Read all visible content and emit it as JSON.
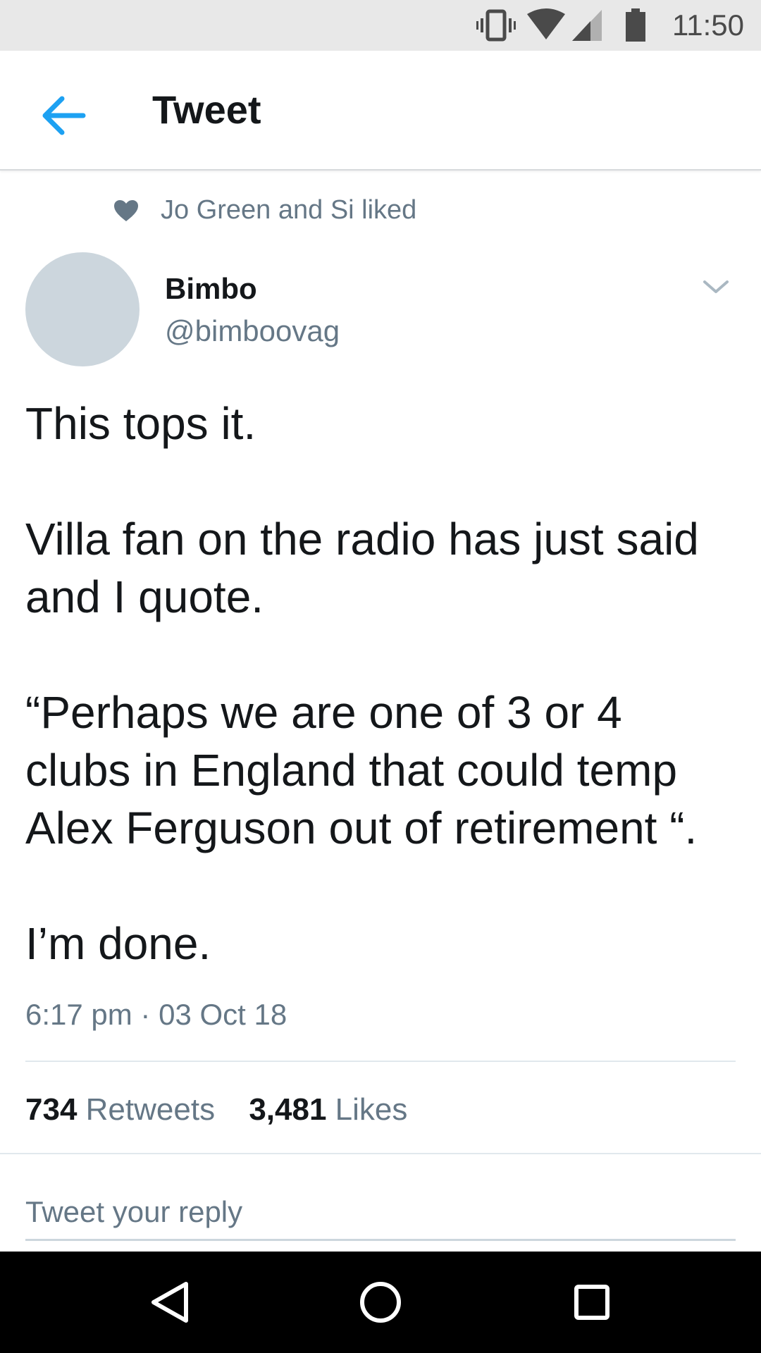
{
  "status_bar": {
    "time": "11:50",
    "icons": [
      "vibrate-icon",
      "wifi-icon",
      "signal-icon",
      "battery-icon"
    ]
  },
  "app_bar": {
    "title": "Tweet",
    "back_icon": "arrow-left-icon",
    "accent_color": "#1da1f2"
  },
  "social_context": {
    "text": "Jo Green and Si liked",
    "icon": "heart-icon"
  },
  "tweet": {
    "author": {
      "name": "Bimbo",
      "handle": "@bimboovag"
    },
    "paragraphs": [
      "This tops it.",
      "Villa fan on the radio has just said and I quote.",
      "“Perhaps we are one of 3 or 4 clubs in England that could temp Alex Ferguson out of retirement “.",
      "I’m done."
    ],
    "timestamp": "6:17 pm · 03 Oct 18",
    "stats": {
      "retweets_count": "734",
      "retweets_label": "Retweets",
      "likes_count": "3,481",
      "likes_label": "Likes"
    }
  },
  "reply": {
    "placeholder": "Tweet your reply",
    "value": ""
  },
  "nav_bar": {
    "buttons": [
      "back-triangle-icon",
      "home-circle-icon",
      "recents-square-icon"
    ]
  }
}
